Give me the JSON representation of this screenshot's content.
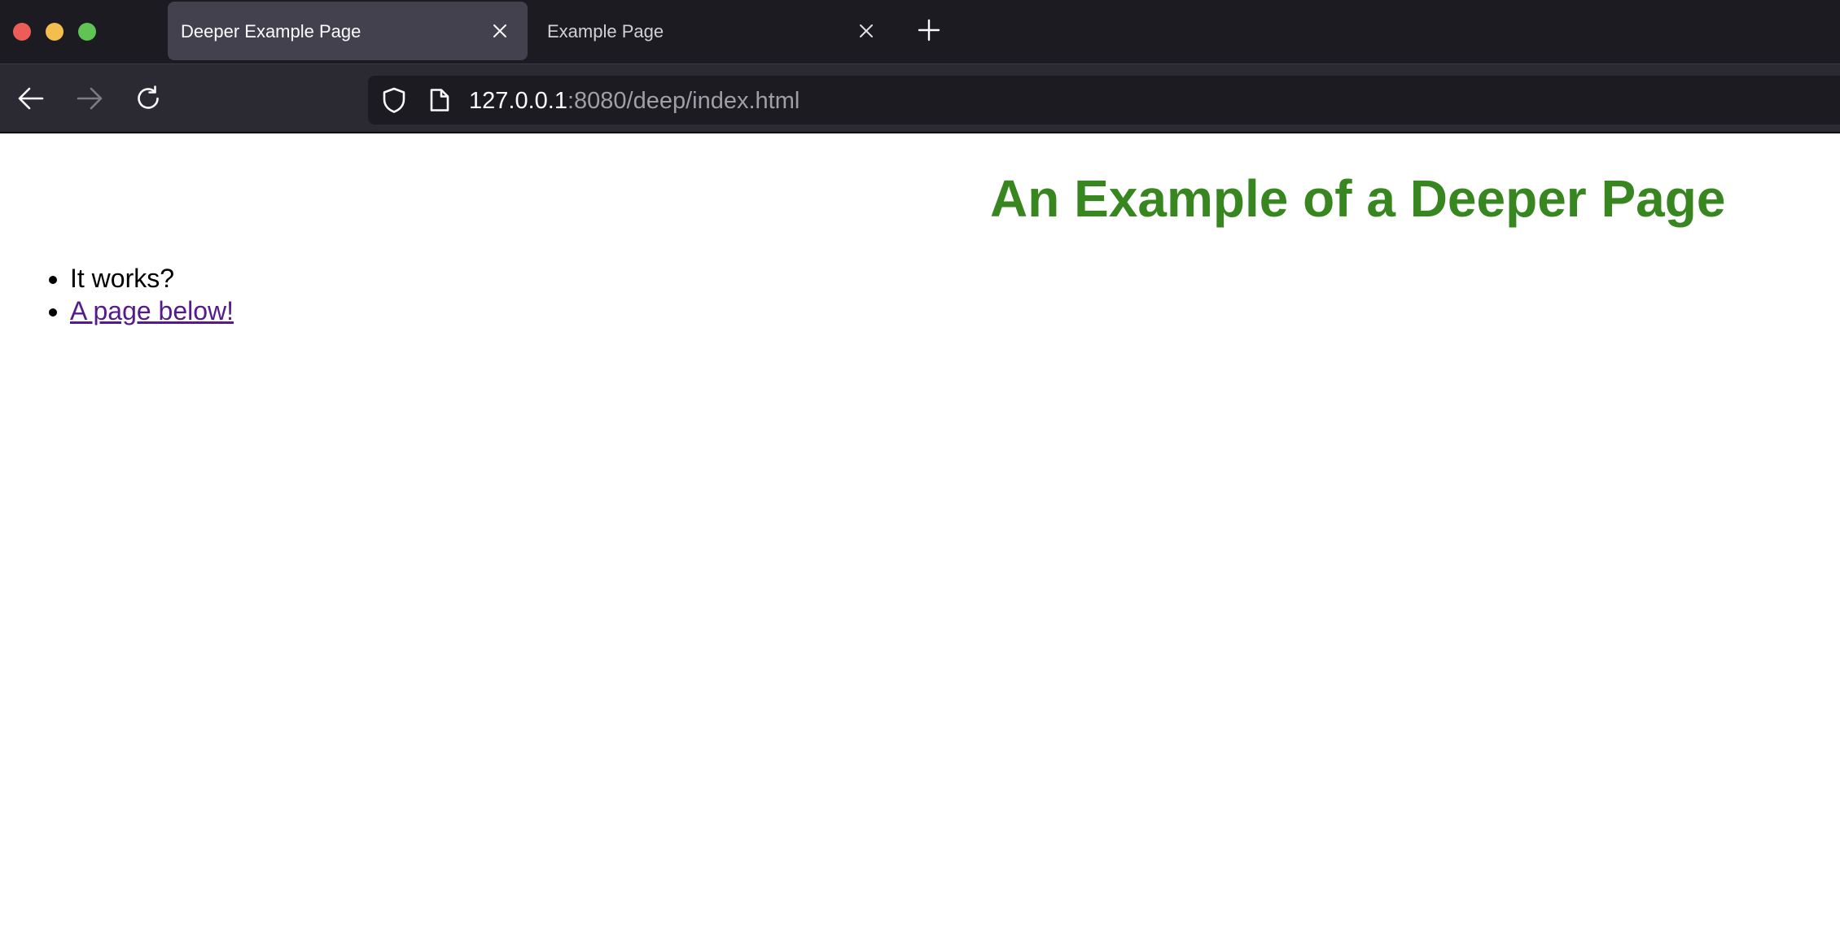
{
  "window": {
    "traffic_lights": {
      "close_color": "#ee5c57",
      "minimize_color": "#f4be4f",
      "maximize_color": "#5fc454"
    }
  },
  "tabs": [
    {
      "title": "Deeper Example Page",
      "active": true
    },
    {
      "title": "Example Page",
      "active": false
    }
  ],
  "navigation": {
    "back_icon": "arrow-left-icon",
    "forward_icon": "arrow-right-icon",
    "reload_icon": "reload-icon",
    "forward_enabled": false
  },
  "address_bar": {
    "host": "127.0.0.1",
    "path": ":8080/deep/index.html"
  },
  "page": {
    "heading": "An Example of a Deeper Page",
    "heading_color": "#38861f",
    "list_items": [
      {
        "text": "It works?",
        "is_link": false
      },
      {
        "text": "A page below!",
        "is_link": true
      }
    ]
  }
}
